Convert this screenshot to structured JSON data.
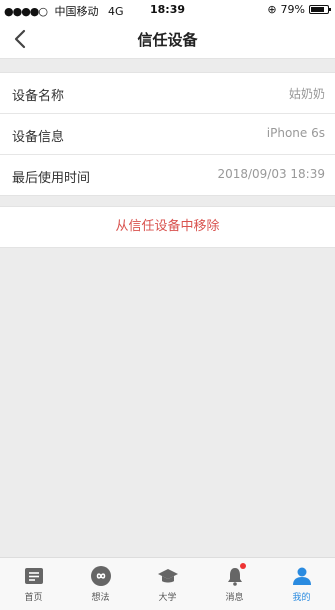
{
  "status": {
    "carrier": "中国移动",
    "network": "4G",
    "time": "18:39",
    "battery_percent": "79%",
    "battery_level": 0.79
  },
  "nav": {
    "title": "信任设备"
  },
  "device": {
    "rows": [
      {
        "label": "设备名称",
        "value": "姑奶奶"
      },
      {
        "label": "设备信息",
        "value": "iPhone 6s"
      },
      {
        "label": "最后使用时间",
        "value": "2018/09/03 18:39"
      }
    ]
  },
  "actions": {
    "remove_label": "从信任设备中移除"
  },
  "tabbar": {
    "tabs": [
      {
        "label": "首页",
        "icon": "home-doc-icon"
      },
      {
        "label": "想法",
        "icon": "infinity-icon"
      },
      {
        "label": "大学",
        "icon": "graduation-cap-icon"
      },
      {
        "label": "消息",
        "icon": "bell-icon"
      },
      {
        "label": "我的",
        "icon": "person-icon"
      }
    ],
    "active_index": 4,
    "accent": "#2a8be0"
  }
}
